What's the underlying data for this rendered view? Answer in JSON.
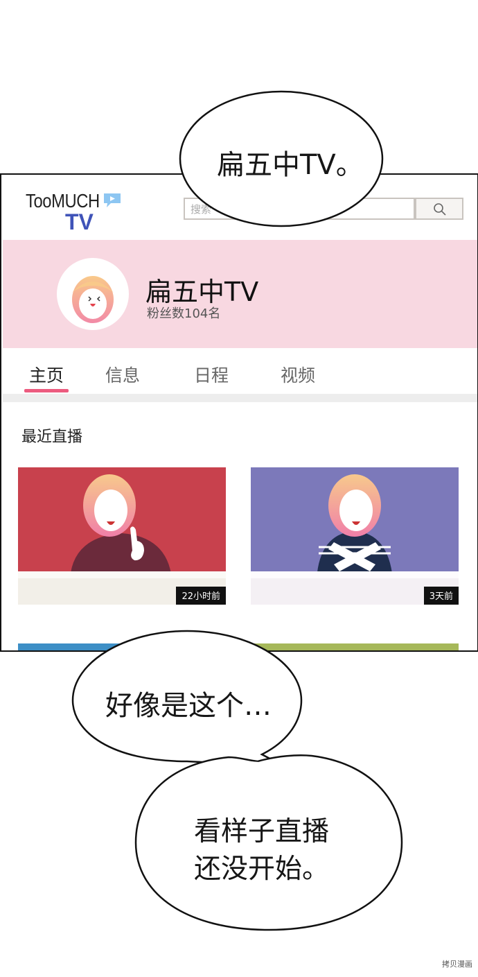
{
  "bubbles": {
    "top": "扁五中TV。",
    "middle": "好像是这个…",
    "bottom_line1": "看样子直播",
    "bottom_line2": "还没开始。"
  },
  "screen": {
    "logo": {
      "line1": "TooMUCH",
      "line2": "TV",
      "brand_color": "#3f53b8"
    },
    "search": {
      "placeholder": "搜索",
      "icon": "search-icon"
    },
    "channel": {
      "name": "扁五中TV",
      "fans": "粉丝数104名",
      "banner_color": "#f8d8e1"
    },
    "tabs": [
      {
        "label": "主页",
        "active": true
      },
      {
        "label": "信息",
        "active": false
      },
      {
        "label": "日程",
        "active": false
      },
      {
        "label": "视频",
        "active": false
      }
    ],
    "accent_color": "#ec5b7f",
    "section_title": "最近直播",
    "videos": [
      {
        "time": "22小时前",
        "bg_color": "#c8414d"
      },
      {
        "time": "3天前",
        "bg_color": "#7c79ba"
      }
    ]
  },
  "watermark": "拷贝漫画"
}
